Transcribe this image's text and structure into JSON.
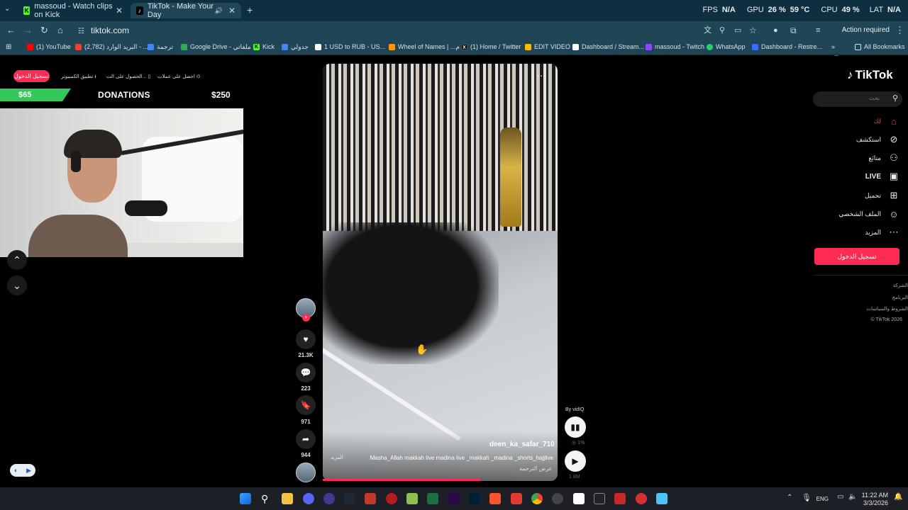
{
  "browser": {
    "tabs": [
      {
        "title": "massoud - Watch clips on Kick",
        "icon": "kick-icon"
      },
      {
        "title": "TikTok - Make Your Day",
        "icon": "tiktok-icon"
      }
    ],
    "new_tab": "+",
    "url": "tiktok.com",
    "action_required": "Action required",
    "perf": {
      "fps_label": "FPS",
      "fps": "N/A",
      "gpu_label": "GPU",
      "gpu": "26 %",
      "gpu_temp": "59 °C",
      "cpu_label": "CPU",
      "cpu": "49 %",
      "lat_label": "LAT",
      "lat": "N/A"
    }
  },
  "bookmarks": [
    {
      "label": "(1) YouTube",
      "color": "#ff0000"
    },
    {
      "label": "(2,782) البريد الوارد - ...",
      "color": "#ea4335"
    },
    {
      "label": "ترجمة",
      "color": "#4285f4"
    },
    {
      "label": "Google Drive - ملفاتي",
      "color": "#34a853"
    },
    {
      "label": "Kick",
      "color": "#53fc18"
    },
    {
      "label": "جدولي",
      "color": "#4285f4"
    },
    {
      "label": "1 USD to RUB - US...",
      "color": "#ffffff"
    },
    {
      "label": "Wheel of Names | ...م",
      "color": "#ff9800"
    },
    {
      "label": "(1) Home / Twitter",
      "color": "#000000"
    },
    {
      "label": "EDIT VIDEO",
      "color": "#fbbc04"
    },
    {
      "label": "Dashboard / Stream...",
      "color": "#ffffff"
    },
    {
      "label": "massoud - Twitch",
      "color": "#9146ff"
    },
    {
      "label": "WhatsApp",
      "color": "#25d366"
    },
    {
      "label": "Dashboard - Restre...",
      "color": "#3b6cff"
    }
  ],
  "all_bookmarks": "All Bookmarks",
  "overlay": {
    "login": "تسجيل الدخول",
    "items": [
      "احصل على عملات",
      "الحصول على الت...",
      "تطبيق الكمبيوتر"
    ],
    "donation_current": "$65",
    "donation_title": "DONATIONS",
    "donation_goal": "$250",
    "donation_progress": 0.26
  },
  "video": {
    "username": "deen_ka_safar_710",
    "caption": "Masha_Allah makkah live madina live _makkah _madina _shorts_hajjlive",
    "more": "المزيد",
    "translate": "عرض الترجمة",
    "progress": 0.67
  },
  "actions": {
    "likes": "21.3K",
    "comments": "223",
    "saves": "971",
    "shares": "944"
  },
  "vidiq": {
    "by": "By vidIQ",
    "pct": "1%",
    "views": "1.8M"
  },
  "tiktok": {
    "logo": "TikTok",
    "search_placeholder": "بحث",
    "nav": [
      {
        "label": "لك",
        "icon": "home-icon",
        "active": true
      },
      {
        "label": "استكشف",
        "icon": "compass-icon"
      },
      {
        "label": "متابَع",
        "icon": "following-icon"
      },
      {
        "label": "LIVE",
        "icon": "live-icon"
      },
      {
        "label": "تحميل",
        "icon": "upload-icon"
      },
      {
        "label": "الملف الشخصي",
        "icon": "profile-icon"
      },
      {
        "label": "المزيد",
        "icon": "more-icon"
      }
    ],
    "login": "تسجيل الدخول",
    "footer": [
      "الشركة",
      "البرنامج",
      "الشروط والسياسات",
      "© TikTok 2026"
    ]
  },
  "taskbar": {
    "lang": "ENG",
    "time": "11:22 AM",
    "date": "3/3/2026"
  }
}
